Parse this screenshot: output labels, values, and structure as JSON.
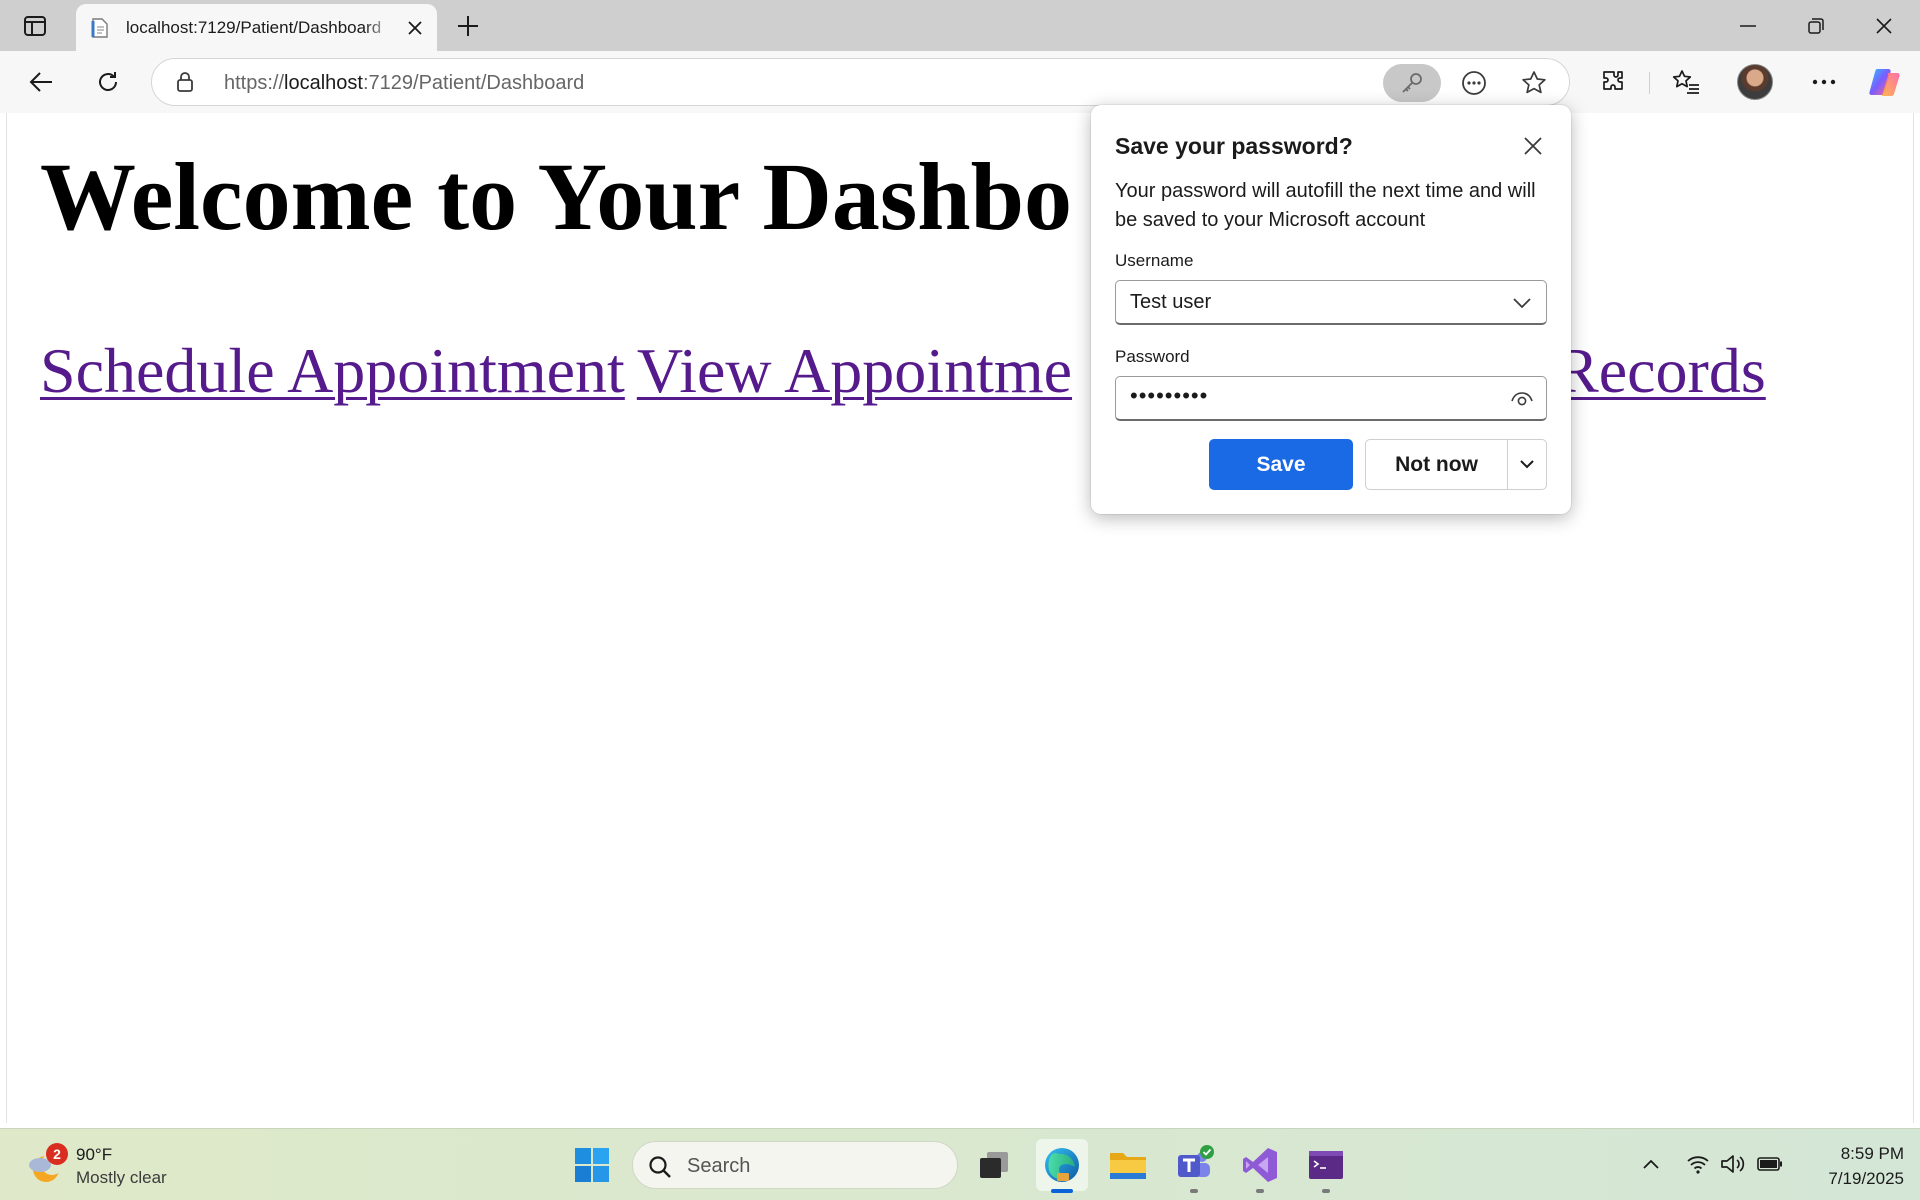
{
  "browser": {
    "tab": {
      "title": "localhost:7129/Patient/Dashboard"
    },
    "address_bar": {
      "scheme": "https://",
      "host": "localhost",
      "path": ":7129/Patient/Dashboard"
    }
  },
  "page": {
    "heading": "Welcome to Your Dashbo",
    "links": [
      {
        "label": "Schedule Appointment"
      },
      {
        "label": "View Appointme"
      },
      {
        "label": "Records"
      }
    ]
  },
  "password_popup": {
    "title": "Save your password?",
    "description": "Your password will autofill the next time and will be saved to your Microsoft account",
    "username_label": "Username",
    "username_value": "Test user",
    "password_label": "Password",
    "password_value": "•••••••••",
    "save_label": "Save",
    "not_now_label": "Not now",
    "accent_color": "#1a6ae5"
  },
  "taskbar": {
    "weather": {
      "badge": "2",
      "temp": "90°F",
      "condition": "Mostly clear"
    },
    "search_placeholder": "Search",
    "clock": {
      "time": "8:59 PM",
      "date": "7/19/2025"
    }
  }
}
